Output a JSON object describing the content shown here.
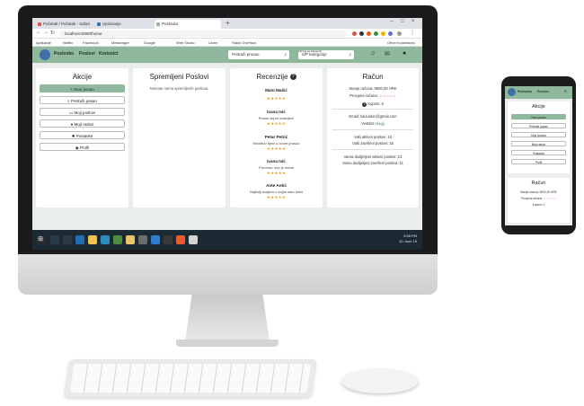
{
  "browser": {
    "tabs": [
      "Početak / Početak - Safari",
      "Upisivanje",
      "Poslovko"
    ],
    "url": "localhost:8080/home",
    "bookmarks": [
      "Aplikacije",
      "Netflix",
      "Facebook",
      "Messenger",
      "Google",
      "Web Studio",
      "Learn",
      "Stack Overflow",
      "Other bookmarks"
    ]
  },
  "app": {
    "brand": "Poslovko",
    "nav": [
      "Poslovi",
      "Korisnici"
    ],
    "search_placeholder": "Pretraži prosao",
    "filter_label": "Filtriraj po kategoriji",
    "filter_value": "IZP kategorije"
  },
  "akcije": {
    "title": "Akcije",
    "buttons": [
      {
        "icon": "+",
        "label": "Novi posao"
      },
      {
        "icon": "⌕",
        "label": "Pretraži posao"
      },
      {
        "icon": "▭",
        "label": "Moji poslovi"
      },
      {
        "icon": "●",
        "label": "Moji radovi"
      },
      {
        "icon": "✹",
        "label": "Postavke"
      },
      {
        "icon": "◉",
        "label": "Profil"
      }
    ]
  },
  "spremljeni": {
    "title": "Spremljeni Poslovi",
    "empty": "Nemate nema spremljenih poslova."
  },
  "recenzije": {
    "title": "Recenzije",
    "items": [
      {
        "name": "Mato Mašić",
        "text": "",
        "stars": "★★★★★"
      },
      {
        "name": "Ivana Ivić",
        "text": "Posao super obavljen!",
        "stars": "★★★★★"
      },
      {
        "name": "Petar Petrić",
        "text": "Mnoštvo riječi u ovom prosao",
        "stars": "★★★★★"
      },
      {
        "name": "Ivana Ivić",
        "text": "Poročno, sve je ma!ai",
        "stars": "★★★★★"
      },
      {
        "name": "Ante Antić",
        "text": "Najbolji majstor u kojim sam bolio",
        "stars": "★★★★★"
      }
    ]
  },
  "racun": {
    "title": "Račun",
    "balance": "Stanje računa: 9000,00 HRK",
    "rating_label": "Procjena računa:",
    "rating_stars": "☆☆☆☆☆",
    "coupons": "Kuponi: 0",
    "email": "Email: luka.lukic@gmail.com",
    "status_label": "Vestitet",
    "status_value": "Ulogij",
    "active_jobs": "Vaši aktivni poslovi: 10",
    "finished_jobs": "Vaši završeni poslovi: 15",
    "assigned_active": "Vama dodijeljeni aktivni poslovi: 13",
    "assigned_finished": "Vama dodijeljeni završeni poslovi: 11"
  },
  "taskbar": {
    "time": "4:58 PM",
    "date": "20 June 19"
  },
  "phone": {
    "brand": "Poslovko",
    "nav": "Poslovi",
    "akcije_title": "Akcije",
    "buttons": [
      "Novi posao",
      "Pretraži posao",
      "Moji poslovi",
      "Moji radovi",
      "Postavke",
      "Profil"
    ],
    "racun_title": "Račun",
    "balance": "Stanje računa: 9000,00 HRK",
    "rating_label": "Procjena računa:",
    "rating_stars": "☆☆☆☆☆",
    "coupons": "Kuponi: 0"
  },
  "colors": {
    "accent": "#8fb89c",
    "brand_blue": "#3f6fa8",
    "star": "#e5a318"
  }
}
